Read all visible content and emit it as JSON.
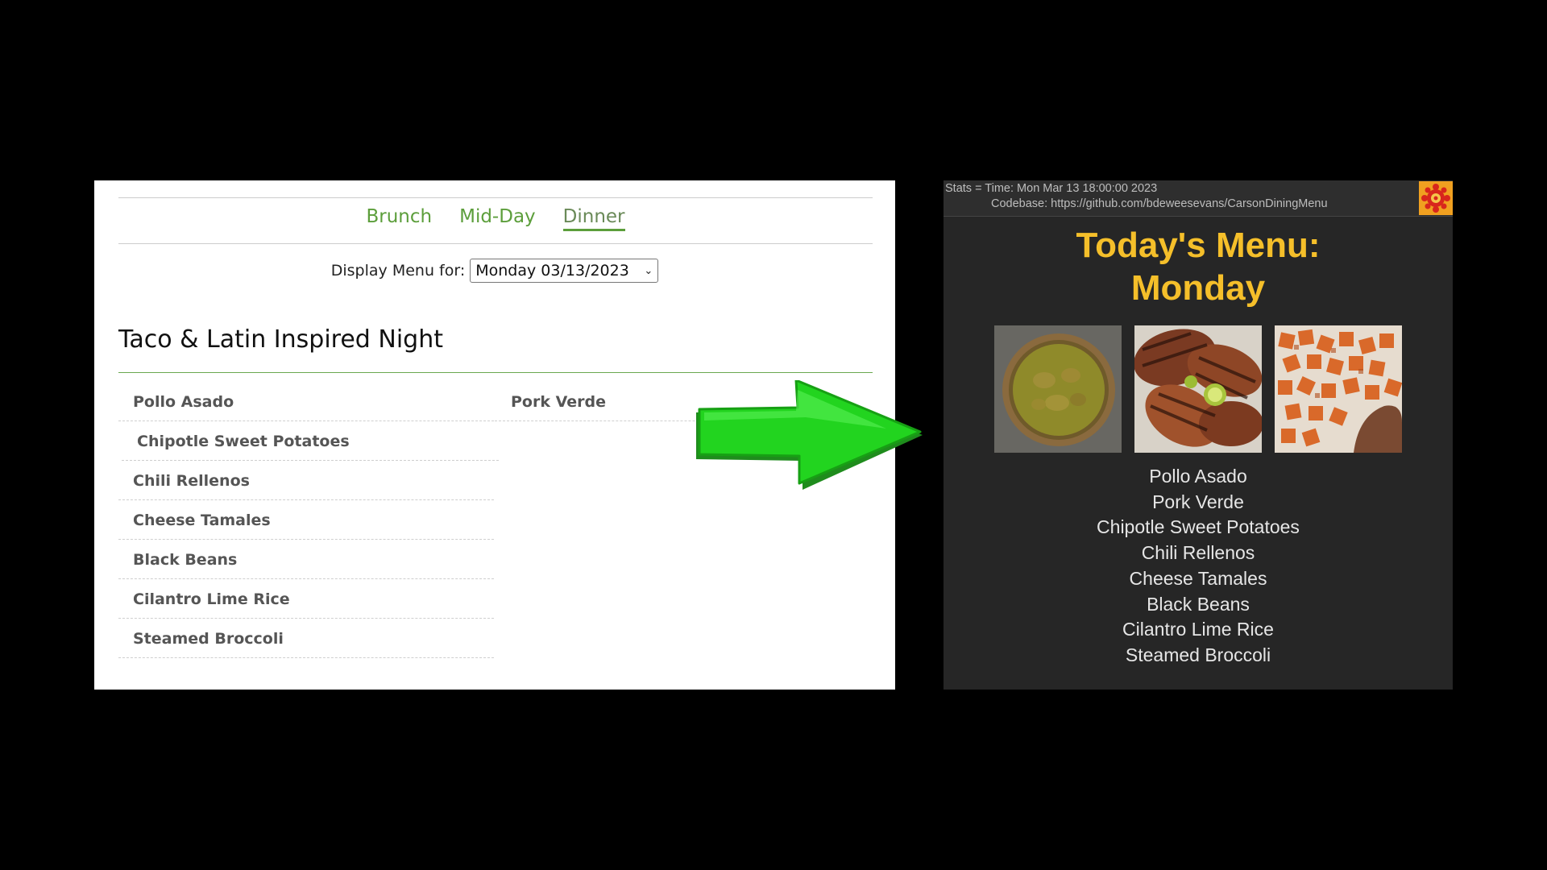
{
  "left": {
    "tabs": [
      "Brunch",
      "Mid-Day",
      "Dinner"
    ],
    "active_tab": "Dinner",
    "display_label": "Display Menu for:",
    "selected_date": "Monday 03/13/2023",
    "theme_title": "Taco & Latin Inspired Night",
    "column1": [
      "Pollo Asado",
      "Chipotle Sweet Potatoes",
      "Chili Rellenos",
      "Cheese Tamales",
      "Black Beans",
      "Cilantro Lime Rice",
      "Steamed Broccoli"
    ],
    "column2": [
      "Pork Verde"
    ]
  },
  "right": {
    "stats_line1": "Stats = Time: Mon Mar 13 18:00:00 2023",
    "stats_line2": "Codebase: https://github.com/bdeweesevans/CarsonDiningMenu",
    "title_line1": "Today's Menu:",
    "title_line2": "Monday",
    "photos": [
      "green-stew-bowl-photo",
      "grilled-chicken-photo",
      "sweet-potato-cubes-photo"
    ],
    "menu_items": [
      "Pollo Asado",
      "Pork Verde",
      "Chipotle Sweet Potatoes",
      "Chili Rellenos",
      "Cheese Tamales",
      "Black Beans",
      "Cilantro Lime Rice",
      "Steamed Broccoli"
    ]
  },
  "colors": {
    "tab_green": "#5c9e3b",
    "title_yellow": "#f5bf2a",
    "arrow_green": "#22c81e",
    "board_bg": "#262626"
  },
  "icons": {
    "arrow": "right-arrow-icon",
    "logo": "flower-logo-icon"
  }
}
